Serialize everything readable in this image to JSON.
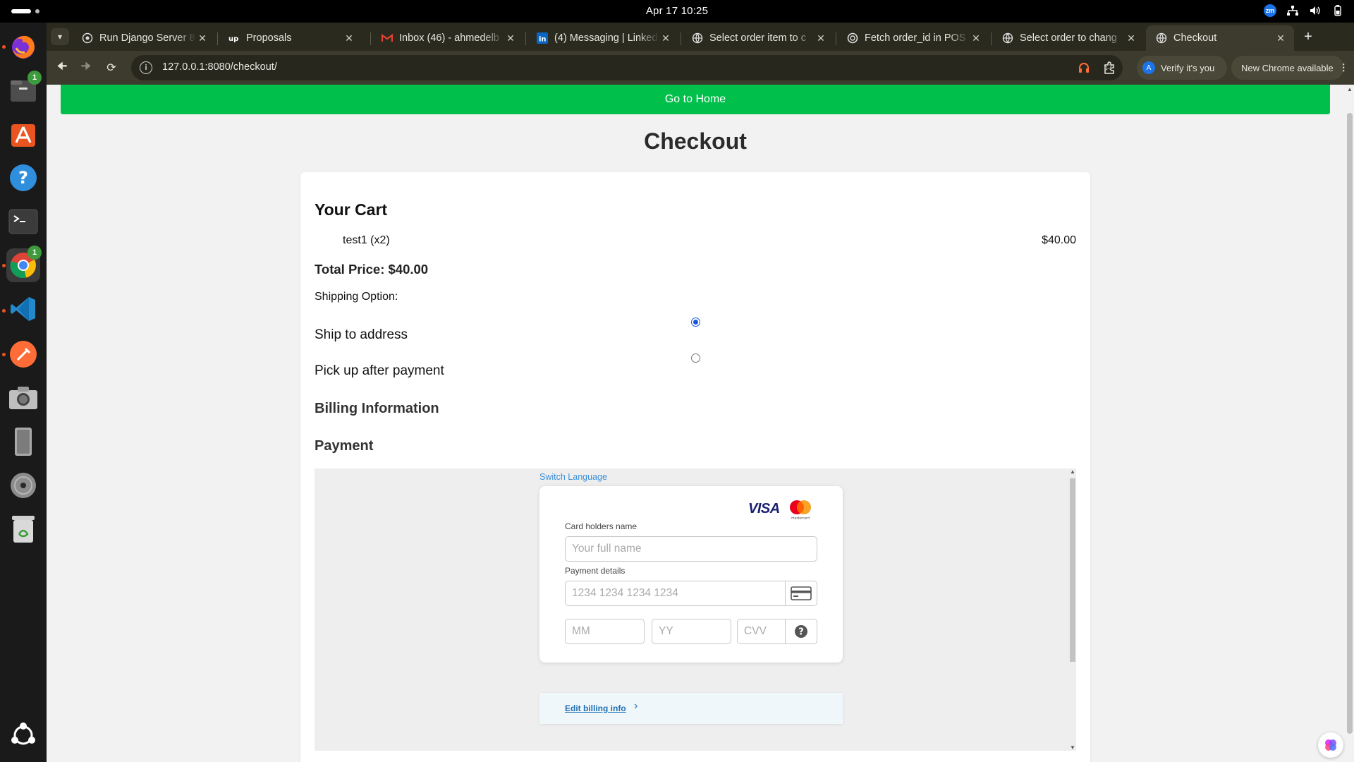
{
  "system": {
    "clock": "Apr 17  10:25",
    "tray_zoom_label": "zm"
  },
  "dock": {
    "files_badge": "1",
    "chrome_badge": "1",
    "items": [
      "firefox-icon",
      "files-icon",
      "app-center-icon",
      "help-icon",
      "terminal-icon",
      "chrome-icon",
      "vscode-icon",
      "postman-icon",
      "screenshot-icon",
      "removable-drive-icon",
      "disc-icon",
      "trash-icon",
      "show-apps-icon"
    ]
  },
  "browser": {
    "tabs": [
      {
        "title": "Run Django Server 80",
        "active": false
      },
      {
        "title": "Proposals",
        "active": false
      },
      {
        "title": "Inbox (46) - ahmedelb",
        "active": false
      },
      {
        "title": "(4) Messaging | Linked",
        "active": false
      },
      {
        "title": "Select order item to c",
        "active": false
      },
      {
        "title": "Fetch order_id in POS",
        "active": false
      },
      {
        "title": "Select order to chang",
        "active": false
      },
      {
        "title": "Checkout",
        "active": true
      }
    ],
    "url": "127.0.0.1:8080/checkout/",
    "verify_label": "Verify it's you",
    "verify_avatar": "A",
    "update_label": "New Chrome available"
  },
  "page": {
    "home_button": "Go to Home",
    "title": "Checkout",
    "cart": {
      "heading": "Your Cart",
      "items": [
        {
          "name": "test1 (x2)",
          "price": "$40.00"
        }
      ],
      "total": "Total Price: $40.00"
    },
    "shipping": {
      "label": "Shipping Option:",
      "options": [
        {
          "label": "Ship to address",
          "selected": true
        },
        {
          "label": "Pick up after payment",
          "selected": false
        }
      ]
    },
    "billing_heading": "Billing Information",
    "payment_heading": "Payment",
    "payment_form": {
      "switch_language": "Switch Language",
      "card_brand_visa": "VISA",
      "card_brand_mc": "mastercard",
      "name_label": "Card holders name",
      "name_placeholder": "Your full name",
      "details_label": "Payment details",
      "card_placeholder": "1234 1234 1234 1234",
      "month_placeholder": "MM",
      "year_placeholder": "YY",
      "cvv_placeholder": "CVV",
      "edit_billing": "Edit billing info"
    }
  },
  "colors": {
    "home_bar": "#00c04b",
    "radio_accent": "#1a56db",
    "link_blue": "#3b8fd9"
  }
}
